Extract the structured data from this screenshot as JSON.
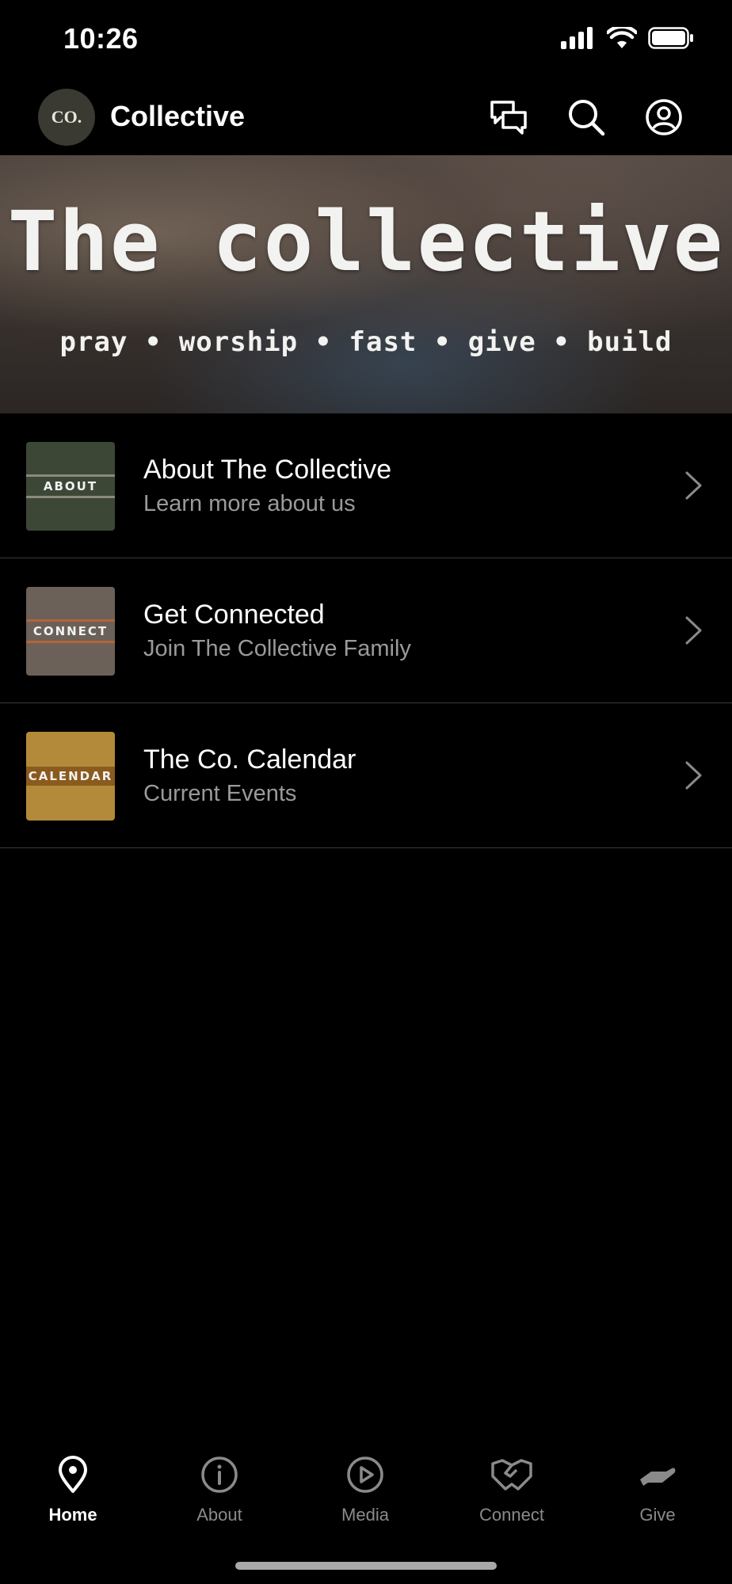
{
  "status_bar": {
    "time": "10:26",
    "icons": [
      "cellular-signal-icon",
      "wifi-icon",
      "battery-icon"
    ]
  },
  "header": {
    "logo_text": "CO.",
    "title": "Collective",
    "actions": [
      "chat-icon",
      "search-icon",
      "profile-icon"
    ]
  },
  "hero": {
    "title": "The collective",
    "subtitle": "pray • worship • fast • give • build"
  },
  "list": [
    {
      "thumb_label": "ABOUT",
      "thumb_color": "#3d4736",
      "band_color": "#8a8a80",
      "title": "About The Collective",
      "subtitle": "Learn more about us"
    },
    {
      "thumb_label": "CONNECT",
      "thumb_color": "#6b6158",
      "band_color": "#b5633a",
      "title": "Get Connected",
      "subtitle": "Join The Collective Family"
    },
    {
      "thumb_label": "CALENDAR",
      "thumb_color": "#b38a3a",
      "band_color": "#8a5a1e",
      "title": "The Co. Calendar",
      "subtitle": "Current Events"
    }
  ],
  "tabs": [
    {
      "label": "Home",
      "icon": "location-pin-icon",
      "active": true
    },
    {
      "label": "About",
      "icon": "info-icon",
      "active": false
    },
    {
      "label": "Media",
      "icon": "play-icon",
      "active": false
    },
    {
      "label": "Connect",
      "icon": "handshake-icon",
      "active": false
    },
    {
      "label": "Give",
      "icon": "giving-hand-icon",
      "active": false
    }
  ],
  "colors": {
    "background": "#000000",
    "text_primary": "#ffffff",
    "text_secondary": "#9a9a9a",
    "tab_inactive": "#8a8a8a",
    "divider": "#3a3a3a"
  }
}
